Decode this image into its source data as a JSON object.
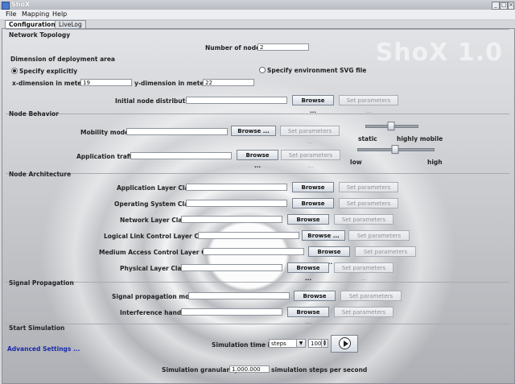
{
  "window": {
    "title": "ShoX"
  },
  "menu": [
    "File",
    "Mapping",
    "Help"
  ],
  "tabs": [
    {
      "label": "Configuration",
      "active": true
    },
    {
      "label": "LiveLog",
      "active": false
    }
  ],
  "watermark": "ShoX 1.0",
  "network_topology": {
    "section_title": "Network Topology",
    "number_of_nodes_label": "Number of nodes",
    "number_of_nodes_value": "2",
    "deployment_area_label": "Dimension of deployment area",
    "specify_explicitly_label": "Specify explicitly",
    "specify_svg_label": "Specify environment SVG file",
    "x_dimension_label": "x-dimension in meters",
    "x_dimension_value": "19",
    "y_dimension_label": "y-dimension in meters",
    "y_dimension_value": "22",
    "initial_distribution_label": "Initial node distribution"
  },
  "node_behavior": {
    "section_title": "Node Behavior",
    "mobility_label": "Mobility model",
    "application_traffic_label": "Application traffic",
    "slider_mobility": {
      "left": "static",
      "right": "highly mobile",
      "value": 0.5
    },
    "slider_traffic": {
      "left": "low",
      "right": "high",
      "value": 0.5
    }
  },
  "node_architecture": {
    "section_title": "Node Architecture",
    "application_layer_label": "Application Layer Class",
    "operating_system_label": "Operating System Class",
    "network_layer_label": "Network Layer Class",
    "llc_label": "Logical Link Control Layer Class",
    "mac_label": "Medium Access Control Layer Class",
    "physical_layer_label": "Physical Layer Class"
  },
  "signal_propagation": {
    "section_title": "Signal Propagation",
    "model_label": "Signal propagation model",
    "interference_label": "Interference handler"
  },
  "start_simulation": {
    "section_title": "Start Simulation",
    "advanced_settings_label": "Advanced Settings ...",
    "simulation_time_label": "Simulation time in",
    "time_unit": "steps",
    "time_value": "100",
    "granularity_label": "Simulation granularity",
    "granularity_value": "1.000.000",
    "granularity_unit_label": "simulation steps per second"
  },
  "buttons": {
    "browse": "Browse ...",
    "set_parameters": "Set parameters ..."
  }
}
